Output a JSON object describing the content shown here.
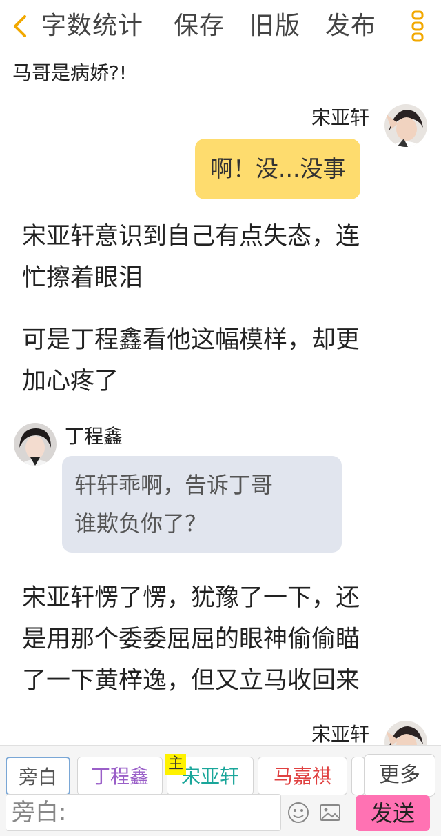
{
  "toolbar": {
    "word_count": "字数统计",
    "save": "保存",
    "old_version": "旧版",
    "publish": "发布"
  },
  "story": {
    "title": "马哥是病娇?!"
  },
  "messages": [
    {
      "speaker": "宋亚轩",
      "text": "啊！没...没事"
    },
    {
      "text_lines": [
        "宋亚轩意识到自己有点失态，连",
        "忙擦着眼泪"
      ]
    },
    {
      "text_lines": [
        "可是丁程鑫看他这幅模样，却更",
        "加心疼了"
      ]
    },
    {
      "speaker": "丁程鑫",
      "text_lines": [
        "轩轩乖啊，告诉丁哥",
        "谁欺负你了？"
      ]
    },
    {
      "text_lines": [
        "宋亚轩愣了愣，犹豫了一下，还",
        "是用那个委委屈屈的眼神偷偷瞄",
        "了一下黄梓逸，但又立马收回来"
      ]
    },
    {
      "speaker": "宋亚轩"
    }
  ],
  "roles": {
    "items": [
      "旁白",
      "丁程鑫",
      "宋亚轩",
      "马嘉祺"
    ],
    "master_tag": "主",
    "more": "更多"
  },
  "composer": {
    "placeholder": "旁白:",
    "send": "发送"
  },
  "colors": {
    "yellow_bubble": "#fedc6e",
    "gray_bubble": "#e1e5ee",
    "send_button": "#ff72b3",
    "back_arrow": "#f2a800",
    "role_dingchengxin": "#9a5fc8",
    "role_songyaxuan": "#1aa69a",
    "role_majiaqi": "#e04040"
  }
}
